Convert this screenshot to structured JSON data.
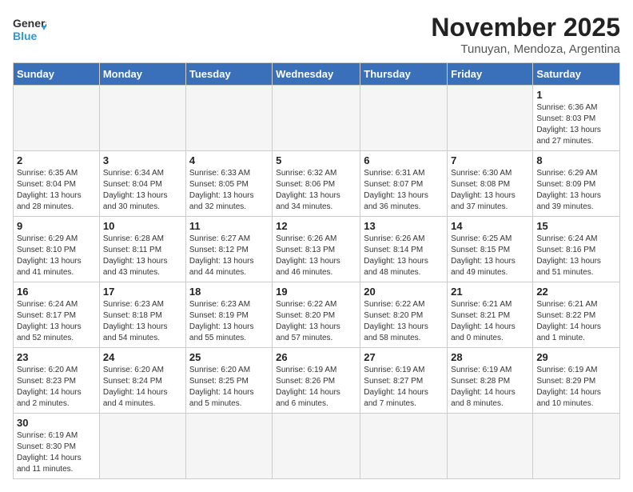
{
  "header": {
    "logo_general": "General",
    "logo_blue": "Blue",
    "month": "November 2025",
    "location": "Tunuyan, Mendoza, Argentina"
  },
  "weekdays": [
    "Sunday",
    "Monday",
    "Tuesday",
    "Wednesday",
    "Thursday",
    "Friday",
    "Saturday"
  ],
  "weeks": [
    [
      {
        "day": "",
        "info": ""
      },
      {
        "day": "",
        "info": ""
      },
      {
        "day": "",
        "info": ""
      },
      {
        "day": "",
        "info": ""
      },
      {
        "day": "",
        "info": ""
      },
      {
        "day": "",
        "info": ""
      },
      {
        "day": "1",
        "info": "Sunrise: 6:36 AM\nSunset: 8:03 PM\nDaylight: 13 hours\nand 27 minutes."
      }
    ],
    [
      {
        "day": "2",
        "info": "Sunrise: 6:35 AM\nSunset: 8:04 PM\nDaylight: 13 hours\nand 28 minutes."
      },
      {
        "day": "3",
        "info": "Sunrise: 6:34 AM\nSunset: 8:04 PM\nDaylight: 13 hours\nand 30 minutes."
      },
      {
        "day": "4",
        "info": "Sunrise: 6:33 AM\nSunset: 8:05 PM\nDaylight: 13 hours\nand 32 minutes."
      },
      {
        "day": "5",
        "info": "Sunrise: 6:32 AM\nSunset: 8:06 PM\nDaylight: 13 hours\nand 34 minutes."
      },
      {
        "day": "6",
        "info": "Sunrise: 6:31 AM\nSunset: 8:07 PM\nDaylight: 13 hours\nand 36 minutes."
      },
      {
        "day": "7",
        "info": "Sunrise: 6:30 AM\nSunset: 8:08 PM\nDaylight: 13 hours\nand 37 minutes."
      },
      {
        "day": "8",
        "info": "Sunrise: 6:29 AM\nSunset: 8:09 PM\nDaylight: 13 hours\nand 39 minutes."
      }
    ],
    [
      {
        "day": "9",
        "info": "Sunrise: 6:29 AM\nSunset: 8:10 PM\nDaylight: 13 hours\nand 41 minutes."
      },
      {
        "day": "10",
        "info": "Sunrise: 6:28 AM\nSunset: 8:11 PM\nDaylight: 13 hours\nand 43 minutes."
      },
      {
        "day": "11",
        "info": "Sunrise: 6:27 AM\nSunset: 8:12 PM\nDaylight: 13 hours\nand 44 minutes."
      },
      {
        "day": "12",
        "info": "Sunrise: 6:26 AM\nSunset: 8:13 PM\nDaylight: 13 hours\nand 46 minutes."
      },
      {
        "day": "13",
        "info": "Sunrise: 6:26 AM\nSunset: 8:14 PM\nDaylight: 13 hours\nand 48 minutes."
      },
      {
        "day": "14",
        "info": "Sunrise: 6:25 AM\nSunset: 8:15 PM\nDaylight: 13 hours\nand 49 minutes."
      },
      {
        "day": "15",
        "info": "Sunrise: 6:24 AM\nSunset: 8:16 PM\nDaylight: 13 hours\nand 51 minutes."
      }
    ],
    [
      {
        "day": "16",
        "info": "Sunrise: 6:24 AM\nSunset: 8:17 PM\nDaylight: 13 hours\nand 52 minutes."
      },
      {
        "day": "17",
        "info": "Sunrise: 6:23 AM\nSunset: 8:18 PM\nDaylight: 13 hours\nand 54 minutes."
      },
      {
        "day": "18",
        "info": "Sunrise: 6:23 AM\nSunset: 8:19 PM\nDaylight: 13 hours\nand 55 minutes."
      },
      {
        "day": "19",
        "info": "Sunrise: 6:22 AM\nSunset: 8:20 PM\nDaylight: 13 hours\nand 57 minutes."
      },
      {
        "day": "20",
        "info": "Sunrise: 6:22 AM\nSunset: 8:20 PM\nDaylight: 13 hours\nand 58 minutes."
      },
      {
        "day": "21",
        "info": "Sunrise: 6:21 AM\nSunset: 8:21 PM\nDaylight: 14 hours\nand 0 minutes."
      },
      {
        "day": "22",
        "info": "Sunrise: 6:21 AM\nSunset: 8:22 PM\nDaylight: 14 hours\nand 1 minute."
      }
    ],
    [
      {
        "day": "23",
        "info": "Sunrise: 6:20 AM\nSunset: 8:23 PM\nDaylight: 14 hours\nand 2 minutes."
      },
      {
        "day": "24",
        "info": "Sunrise: 6:20 AM\nSunset: 8:24 PM\nDaylight: 14 hours\nand 4 minutes."
      },
      {
        "day": "25",
        "info": "Sunrise: 6:20 AM\nSunset: 8:25 PM\nDaylight: 14 hours\nand 5 minutes."
      },
      {
        "day": "26",
        "info": "Sunrise: 6:19 AM\nSunset: 8:26 PM\nDaylight: 14 hours\nand 6 minutes."
      },
      {
        "day": "27",
        "info": "Sunrise: 6:19 AM\nSunset: 8:27 PM\nDaylight: 14 hours\nand 7 minutes."
      },
      {
        "day": "28",
        "info": "Sunrise: 6:19 AM\nSunset: 8:28 PM\nDaylight: 14 hours\nand 8 minutes."
      },
      {
        "day": "29",
        "info": "Sunrise: 6:19 AM\nSunset: 8:29 PM\nDaylight: 14 hours\nand 10 minutes."
      }
    ],
    [
      {
        "day": "30",
        "info": "Sunrise: 6:19 AM\nSunset: 8:30 PM\nDaylight: 14 hours\nand 11 minutes."
      },
      {
        "day": "",
        "info": ""
      },
      {
        "day": "",
        "info": ""
      },
      {
        "day": "",
        "info": ""
      },
      {
        "day": "",
        "info": ""
      },
      {
        "day": "",
        "info": ""
      },
      {
        "day": "",
        "info": ""
      }
    ]
  ]
}
